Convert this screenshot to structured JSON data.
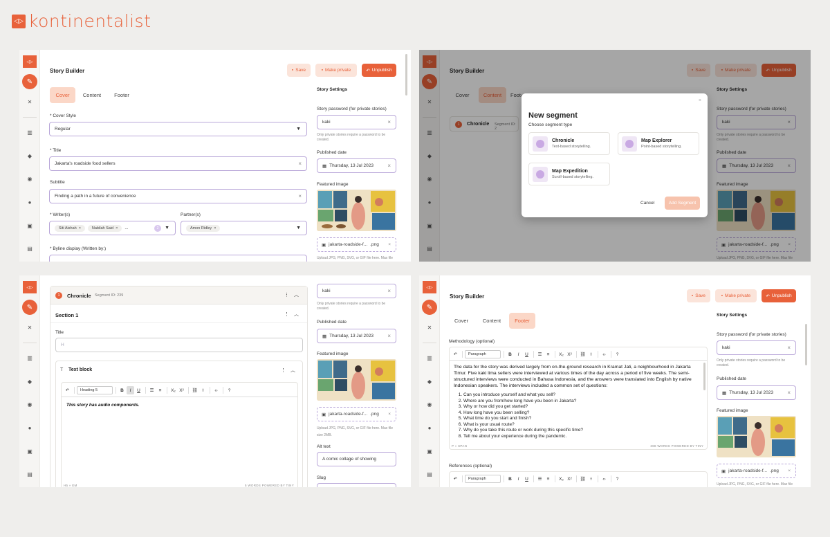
{
  "brand": {
    "name": "kontinentalist",
    "accent": "#e8613a"
  },
  "story_builder": {
    "title": "Story Builder",
    "save_label": "Save",
    "make_private_label": "Make private",
    "unpublish_label": "Unpublish",
    "tabs": [
      "Cover",
      "Content",
      "Footer"
    ]
  },
  "cover_form": {
    "cover_style_label": "* Cover Style",
    "cover_style_value": "Regular",
    "title_label": "* Title",
    "title_value": "Jakarta's roadside food sellers",
    "subtitle_label": "Subtitle",
    "subtitle_value": "Finding a path in a future of convenience",
    "writers_label": "* Writer(s)",
    "writers": [
      "Siti Aishah",
      "Nabilah Said"
    ],
    "writers_more": "...",
    "writers_count": "2",
    "partners_label": "Partner(s)",
    "partners": [
      "Amon Ridley"
    ],
    "byline_label": "* Byline display (Written by:)"
  },
  "settings": {
    "heading": "Story Settings",
    "password_label": "Story password (for private stories)",
    "password_value": "kaki",
    "password_hint": "Only private stories require a password to be created.",
    "published_label": "Published date",
    "published_value": "Thursday, 13 Jul 2023",
    "featured_label": "Featured image",
    "file_name": "jakarta-roadside-f...",
    "file_ext": ".png",
    "upload_hint": "Upload JPG, PNG, SVG, or GIF file here. Max file",
    "upload_hint2": "size 2MB.",
    "alt_label": "Alt text",
    "alt_value": "A comic collage of showing",
    "slug_label": "Slug"
  },
  "content_tab": {
    "segment_num": "1",
    "segment_title": "Chronicle",
    "segment_id": "Segment ID: 239",
    "segment_id_short": "Segment ID: 2"
  },
  "modal": {
    "title": "New segment",
    "subtitle": "Choose segment type",
    "options": [
      {
        "title": "Chronicle",
        "desc": "Text-based storytelling."
      },
      {
        "title": "Map Explorer",
        "desc": "Point-based storytelling."
      },
      {
        "title": "Map Expedition",
        "desc": "Scroll-based storytelling."
      }
    ],
    "cancel_label": "Cancel",
    "add_label": "Add Segment"
  },
  "segment_editor": {
    "section_title": "Section 1",
    "title_label": "Title",
    "title_placeholder": "H",
    "block_title": "Text block",
    "heading_select": "Heading 5",
    "body": "This story has audio components.",
    "status_left": "H5 » EM",
    "status_right": "5 WORDS  POWERED BY TINY"
  },
  "footer_tab": {
    "methodology_label": "Methodology (optional)",
    "paragraph_select": "Paragraph",
    "methodology_text": "The data for the story was derived largely from on-the-ground research in Kramat Jati, a neighbourhood in Jakarta Timur. Five kaki lima sellers were interviewed at various times of the day across a period of five weeks. The semi-structured interviews were conducted in Bahasa Indonesia, and the answers were translated into English by native Indonesian speakers. The interviews included a common set of questions:",
    "questions": [
      "Can you introduce yourself and what you sell?",
      "Where are you from/how long have you been in Jakarta?",
      "Why or how did you get started?",
      "How long have you been selling?",
      "What time do you start and finish?",
      "What is your usual route?",
      "Why do you take this route or work during this specific time?",
      "Tell me about your experience during the pandemic."
    ],
    "status_left": "P » SPAN",
    "status_right": "388 WORDS  POWERED BY TINY",
    "references_label": "References (optional)"
  }
}
